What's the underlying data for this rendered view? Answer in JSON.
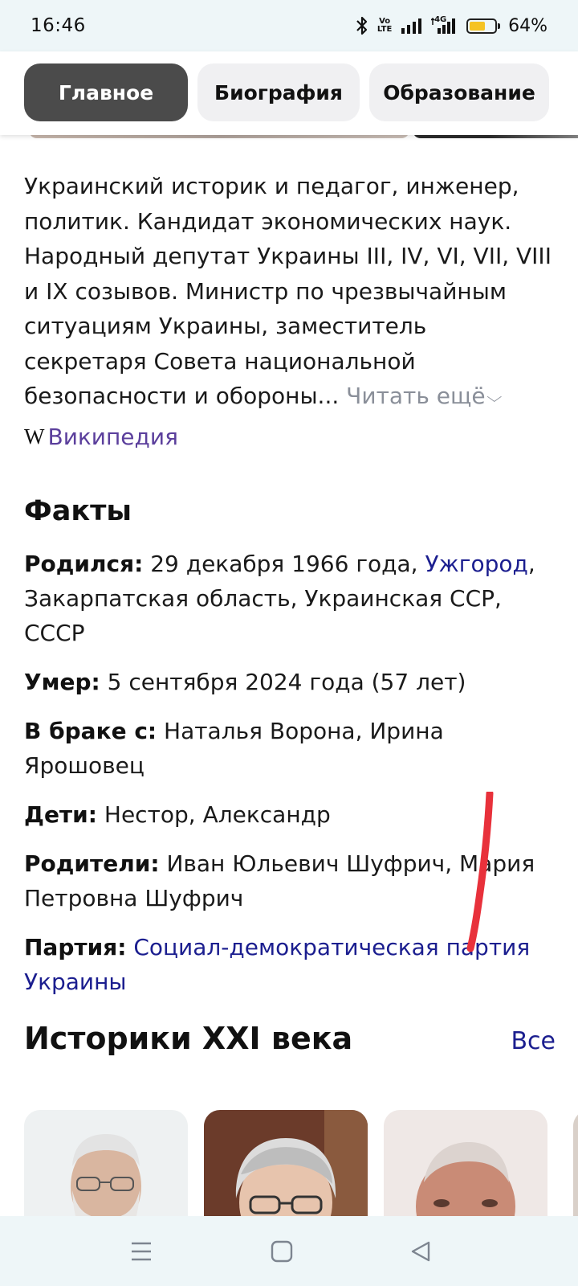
{
  "status_bar": {
    "time": "16:46",
    "battery_percent": "64%",
    "battery_level": 0.64,
    "net_label": "4G",
    "volte_label": "Vo LTE",
    "icons": [
      "bluetooth-icon",
      "volte-icon",
      "signal-icon",
      "4g-signal-icon",
      "battery-icon"
    ]
  },
  "tabs": [
    {
      "label": "Главное",
      "active": true
    },
    {
      "label": "Биография",
      "active": false
    },
    {
      "label": "Образование",
      "active": false
    }
  ],
  "summary": {
    "text": "Украинский историк и педагог, инженер, политик. Кандидат экономических наук. Народный депутат Украины III, IV, VI, VII, VIII и IX созывов. Министр по чрезвычайным ситуациям Украины, заместитель секретаря Совета национальной безопасности и обороны...",
    "read_more": "Читать ещё",
    "source_logo": "W",
    "source_label": "Википедия"
  },
  "facts": {
    "title": "Факты",
    "items": [
      {
        "label": "Родился:",
        "text_before": "29 декабря 1966 года,",
        "link": "Ужгород",
        "text_after": ", Закарпатская область, Украинская ССР, СССР"
      },
      {
        "label": "Умер:",
        "text_before": "5 сентября 2024 года (57 лет)",
        "link": "",
        "text_after": ""
      },
      {
        "label": "В браке с:",
        "text_before": "Наталья Ворона, Ирина Ярошовец",
        "link": "",
        "text_after": ""
      },
      {
        "label": "Дети:",
        "text_before": "Нестор, Александр",
        "link": "",
        "text_after": ""
      },
      {
        "label": "Родители:",
        "text_before": "Иван Юльевич Шуфрич, Мария Петровна Шуфрич",
        "link": "",
        "text_after": ""
      },
      {
        "label": "Партия:",
        "text_before": "",
        "link": "Социал-демократическая партия Украины",
        "text_after": ""
      }
    ]
  },
  "related": {
    "title": "Историки XXI века",
    "all_label": "Все"
  },
  "colors": {
    "link": "#1b1e8f",
    "wiki_link": "#5b3f9c",
    "read_more": "#8a8f99",
    "active_tab": "#4b4b4b",
    "system_bar": "#eef6f8",
    "battery_fill": "#f5c323",
    "scribble": "#e8313b"
  }
}
